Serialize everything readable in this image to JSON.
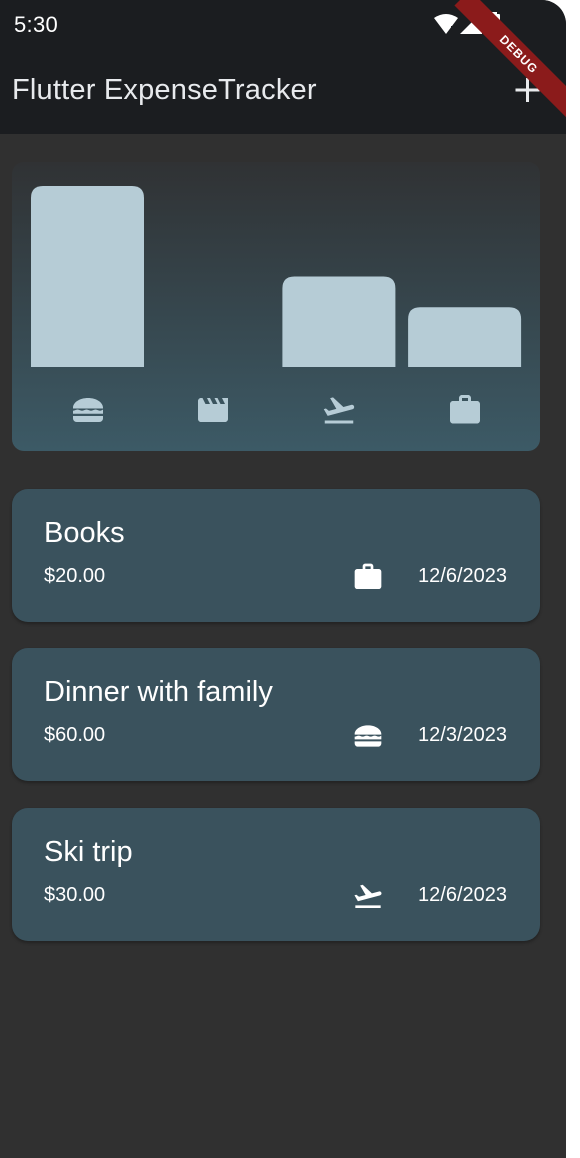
{
  "status": {
    "time": "5:30"
  },
  "debug_banner": "DEBUG",
  "appbar": {
    "title": "Flutter ExpenseTracker",
    "add_icon": "plus-icon"
  },
  "chart_data": {
    "type": "bar",
    "categories": [
      "food",
      "leisure",
      "travel",
      "work"
    ],
    "values": [
      1,
      0,
      0.5,
      0.33
    ],
    "icons": [
      "burger-icon",
      "movie-icon",
      "flight-takeoff-icon",
      "briefcase-icon"
    ],
    "bar_color": "#b6ccd6"
  },
  "expenses": [
    {
      "title": "Books",
      "amount": "$20.00",
      "date": "12/6/2023",
      "category": "work",
      "icon": "briefcase-icon"
    },
    {
      "title": "Dinner with family",
      "amount": "$60.00",
      "date": "12/3/2023",
      "category": "food",
      "icon": "burger-icon"
    },
    {
      "title": "Ski trip",
      "amount": "$30.00",
      "date": "12/6/2023",
      "category": "travel",
      "icon": "flight-takeoff-icon"
    }
  ],
  "colors": {
    "background": "#303030",
    "appbar": "#1b1d20",
    "card": "#3a525d",
    "bar": "#b6ccd6"
  }
}
